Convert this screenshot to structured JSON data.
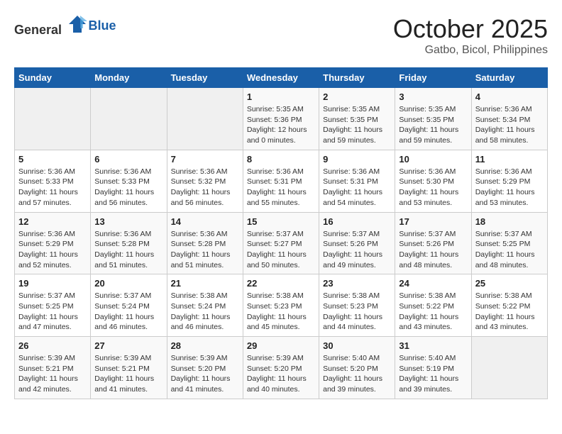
{
  "header": {
    "logo_general": "General",
    "logo_blue": "Blue",
    "month_year": "October 2025",
    "location": "Gatbo, Bicol, Philippines"
  },
  "weekdays": [
    "Sunday",
    "Monday",
    "Tuesday",
    "Wednesday",
    "Thursday",
    "Friday",
    "Saturday"
  ],
  "weeks": [
    [
      {
        "day": "",
        "sunrise": "",
        "sunset": "",
        "daylight": ""
      },
      {
        "day": "",
        "sunrise": "",
        "sunset": "",
        "daylight": ""
      },
      {
        "day": "",
        "sunrise": "",
        "sunset": "",
        "daylight": ""
      },
      {
        "day": "1",
        "sunrise": "Sunrise: 5:35 AM",
        "sunset": "Sunset: 5:36 PM",
        "daylight": "Daylight: 12 hours and 0 minutes."
      },
      {
        "day": "2",
        "sunrise": "Sunrise: 5:35 AM",
        "sunset": "Sunset: 5:35 PM",
        "daylight": "Daylight: 11 hours and 59 minutes."
      },
      {
        "day": "3",
        "sunrise": "Sunrise: 5:35 AM",
        "sunset": "Sunset: 5:35 PM",
        "daylight": "Daylight: 11 hours and 59 minutes."
      },
      {
        "day": "4",
        "sunrise": "Sunrise: 5:36 AM",
        "sunset": "Sunset: 5:34 PM",
        "daylight": "Daylight: 11 hours and 58 minutes."
      }
    ],
    [
      {
        "day": "5",
        "sunrise": "Sunrise: 5:36 AM",
        "sunset": "Sunset: 5:33 PM",
        "daylight": "Daylight: 11 hours and 57 minutes."
      },
      {
        "day": "6",
        "sunrise": "Sunrise: 5:36 AM",
        "sunset": "Sunset: 5:33 PM",
        "daylight": "Daylight: 11 hours and 56 minutes."
      },
      {
        "day": "7",
        "sunrise": "Sunrise: 5:36 AM",
        "sunset": "Sunset: 5:32 PM",
        "daylight": "Daylight: 11 hours and 56 minutes."
      },
      {
        "day": "8",
        "sunrise": "Sunrise: 5:36 AM",
        "sunset": "Sunset: 5:31 PM",
        "daylight": "Daylight: 11 hours and 55 minutes."
      },
      {
        "day": "9",
        "sunrise": "Sunrise: 5:36 AM",
        "sunset": "Sunset: 5:31 PM",
        "daylight": "Daylight: 11 hours and 54 minutes."
      },
      {
        "day": "10",
        "sunrise": "Sunrise: 5:36 AM",
        "sunset": "Sunset: 5:30 PM",
        "daylight": "Daylight: 11 hours and 53 minutes."
      },
      {
        "day": "11",
        "sunrise": "Sunrise: 5:36 AM",
        "sunset": "Sunset: 5:29 PM",
        "daylight": "Daylight: 11 hours and 53 minutes."
      }
    ],
    [
      {
        "day": "12",
        "sunrise": "Sunrise: 5:36 AM",
        "sunset": "Sunset: 5:29 PM",
        "daylight": "Daylight: 11 hours and 52 minutes."
      },
      {
        "day": "13",
        "sunrise": "Sunrise: 5:36 AM",
        "sunset": "Sunset: 5:28 PM",
        "daylight": "Daylight: 11 hours and 51 minutes."
      },
      {
        "day": "14",
        "sunrise": "Sunrise: 5:36 AM",
        "sunset": "Sunset: 5:28 PM",
        "daylight": "Daylight: 11 hours and 51 minutes."
      },
      {
        "day": "15",
        "sunrise": "Sunrise: 5:37 AM",
        "sunset": "Sunset: 5:27 PM",
        "daylight": "Daylight: 11 hours and 50 minutes."
      },
      {
        "day": "16",
        "sunrise": "Sunrise: 5:37 AM",
        "sunset": "Sunset: 5:26 PM",
        "daylight": "Daylight: 11 hours and 49 minutes."
      },
      {
        "day": "17",
        "sunrise": "Sunrise: 5:37 AM",
        "sunset": "Sunset: 5:26 PM",
        "daylight": "Daylight: 11 hours and 48 minutes."
      },
      {
        "day": "18",
        "sunrise": "Sunrise: 5:37 AM",
        "sunset": "Sunset: 5:25 PM",
        "daylight": "Daylight: 11 hours and 48 minutes."
      }
    ],
    [
      {
        "day": "19",
        "sunrise": "Sunrise: 5:37 AM",
        "sunset": "Sunset: 5:25 PM",
        "daylight": "Daylight: 11 hours and 47 minutes."
      },
      {
        "day": "20",
        "sunrise": "Sunrise: 5:37 AM",
        "sunset": "Sunset: 5:24 PM",
        "daylight": "Daylight: 11 hours and 46 minutes."
      },
      {
        "day": "21",
        "sunrise": "Sunrise: 5:38 AM",
        "sunset": "Sunset: 5:24 PM",
        "daylight": "Daylight: 11 hours and 46 minutes."
      },
      {
        "day": "22",
        "sunrise": "Sunrise: 5:38 AM",
        "sunset": "Sunset: 5:23 PM",
        "daylight": "Daylight: 11 hours and 45 minutes."
      },
      {
        "day": "23",
        "sunrise": "Sunrise: 5:38 AM",
        "sunset": "Sunset: 5:23 PM",
        "daylight": "Daylight: 11 hours and 44 minutes."
      },
      {
        "day": "24",
        "sunrise": "Sunrise: 5:38 AM",
        "sunset": "Sunset: 5:22 PM",
        "daylight": "Daylight: 11 hours and 43 minutes."
      },
      {
        "day": "25",
        "sunrise": "Sunrise: 5:38 AM",
        "sunset": "Sunset: 5:22 PM",
        "daylight": "Daylight: 11 hours and 43 minutes."
      }
    ],
    [
      {
        "day": "26",
        "sunrise": "Sunrise: 5:39 AM",
        "sunset": "Sunset: 5:21 PM",
        "daylight": "Daylight: 11 hours and 42 minutes."
      },
      {
        "day": "27",
        "sunrise": "Sunrise: 5:39 AM",
        "sunset": "Sunset: 5:21 PM",
        "daylight": "Daylight: 11 hours and 41 minutes."
      },
      {
        "day": "28",
        "sunrise": "Sunrise: 5:39 AM",
        "sunset": "Sunset: 5:20 PM",
        "daylight": "Daylight: 11 hours and 41 minutes."
      },
      {
        "day": "29",
        "sunrise": "Sunrise: 5:39 AM",
        "sunset": "Sunset: 5:20 PM",
        "daylight": "Daylight: 11 hours and 40 minutes."
      },
      {
        "day": "30",
        "sunrise": "Sunrise: 5:40 AM",
        "sunset": "Sunset: 5:20 PM",
        "daylight": "Daylight: 11 hours and 39 minutes."
      },
      {
        "day": "31",
        "sunrise": "Sunrise: 5:40 AM",
        "sunset": "Sunset: 5:19 PM",
        "daylight": "Daylight: 11 hours and 39 minutes."
      },
      {
        "day": "",
        "sunrise": "",
        "sunset": "",
        "daylight": ""
      }
    ]
  ]
}
